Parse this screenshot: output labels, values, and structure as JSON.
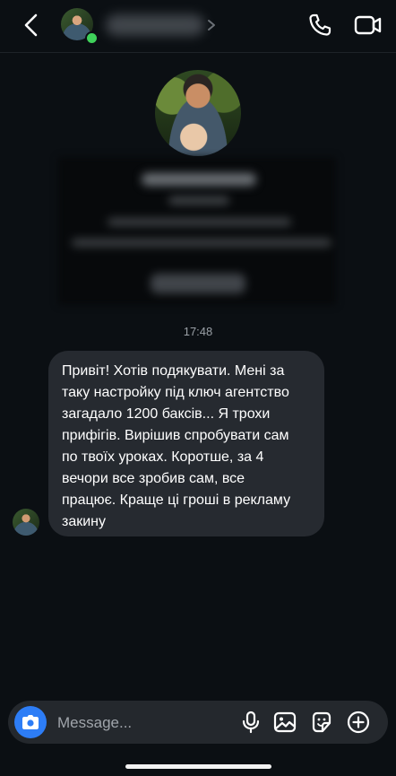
{
  "header": {
    "contact_name": "",
    "icons": [
      "back-icon",
      "phone-icon",
      "video-icon",
      "chevron-right-icon"
    ],
    "online_status_color": "#3fd15a"
  },
  "conversation": {
    "timestamp": "17:48",
    "messages": [
      {
        "direction": "incoming",
        "text": "Привіт! Хотів подякувати. Мені за\nтаку настройку під ключ агентство\nзагадало 1200 баксів... Я трохи\nприфігів. Вирішив спробувати сам\nпо твоїх уроках. Коротше, за 4\nвечори все зробив сам, все\nпрацює. Краще ці гроші в рекламу\nзакину"
      }
    ]
  },
  "composer": {
    "placeholder": "Message...",
    "value": "",
    "accent_color": "#2d7df6",
    "icons": [
      "camera-icon",
      "microphone-icon",
      "image-icon",
      "sticker-icon",
      "plus-circle-icon"
    ]
  }
}
